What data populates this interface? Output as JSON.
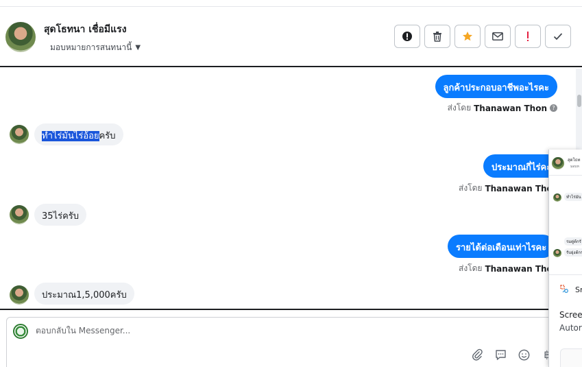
{
  "header": {
    "contact_name": "สุดโธทนา เชื่อมีแรง",
    "assign_label": "มอบหมายการสนทนานี้",
    "actions": [
      {
        "name": "mark-spam-button",
        "icon": "exclamation-circle-icon"
      },
      {
        "name": "delete-button",
        "icon": "trash-icon"
      },
      {
        "name": "star-button",
        "icon": "star-icon",
        "color": "#f5a623"
      },
      {
        "name": "mark-unread-button",
        "icon": "envelope-icon"
      },
      {
        "name": "flag-button",
        "icon": "exclamation-icon",
        "color": "#e41e3f"
      },
      {
        "name": "mark-done-button",
        "icon": "check-icon"
      }
    ]
  },
  "conversation": {
    "messages": [
      {
        "id": "m1",
        "direction": "outgoing",
        "text": "ลูกค้าประกอบอาชีพอะไรคะ",
        "sent_by_label": "ส่งโดย",
        "sender": "Thanawan Thon",
        "help_icon": "?"
      },
      {
        "id": "m2",
        "direction": "incoming",
        "text_highlighted": "ทำไร่มันไร่อ้อย",
        "text_rest": "ครับ"
      },
      {
        "id": "m3",
        "direction": "outgoing",
        "text": "ประมาณกี่ไร่คะ",
        "sent_by_label": "ส่งโดย",
        "sender": "Thanawan Thon"
      },
      {
        "id": "m4",
        "direction": "incoming",
        "text": "35ไร่ครับ"
      },
      {
        "id": "m5",
        "direction": "outgoing",
        "text": "รายได้ต่อเดือนเท่าไรคะ",
        "sent_by_label": "ส่งโดย",
        "sender": "Thanawan Thon"
      },
      {
        "id": "m6",
        "direction": "incoming",
        "text": "ประมาณ1,5,000ครับ"
      }
    ]
  },
  "reply": {
    "placeholder": "ตอบกลับใน Messenger...",
    "tools": [
      "paperclip-icon",
      "speech-bubble-icon",
      "smiley-icon",
      "baht-icon"
    ]
  },
  "overlay": {
    "header_name": "สุดโธท",
    "header_sub": "มอบห",
    "msg_1": "ทำไร่มัน",
    "msg_2": "รมตู่ต้กรั",
    "msg_3": "รับยุ่งต้กร",
    "app_name": "Sn",
    "text_1": "Scree",
    "text_2": "Autor"
  },
  "colors": {
    "outgoing_bubble": "#0a7cff",
    "incoming_bubble": "#f0f2f5",
    "highlight": "#1a56db"
  }
}
